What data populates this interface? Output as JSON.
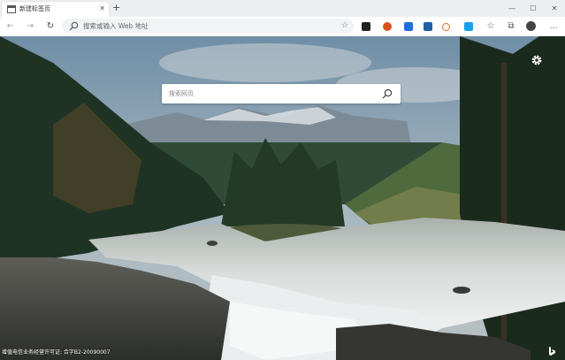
{
  "tab": {
    "title": "新建标签页",
    "close": "✕"
  },
  "new_tab": "+",
  "window_controls": {
    "minimize": "—",
    "maximize": "☐",
    "close": "✕"
  },
  "toolbar": {
    "back": "←",
    "forward": "→",
    "refresh": "↻",
    "address_placeholder": "搜索或输入 Web 地址",
    "favorite": "☆",
    "favorites_bar": "☆",
    "collections": "⧉"
  },
  "extensions": [
    {
      "icon": "reader-extension-icon",
      "color": "#222222"
    },
    {
      "icon": "orange-circle-extension-icon",
      "color": "#d9531e"
    },
    {
      "icon": "translate-extension-icon",
      "color": "#1e6fd9"
    },
    {
      "icon": "screenshot-extension-icon",
      "color": "#1f5fa6"
    },
    {
      "icon": "o-extension-icon",
      "color": "#e06a1c"
    },
    {
      "icon": "blue-square-extension-icon",
      "color": "#1aa0e8"
    },
    {
      "icon": "tools-extension-icon",
      "color": "#2573c9"
    }
  ],
  "new_tab_page": {
    "search_placeholder": "搜索网页",
    "footer_license": "增值电信业务经营许可证: 合字B2-20090007"
  },
  "colors": {
    "accent": "#0078d4",
    "sky": "#7f96a8",
    "forest": "#243a2a",
    "water": "#d6dad8"
  }
}
